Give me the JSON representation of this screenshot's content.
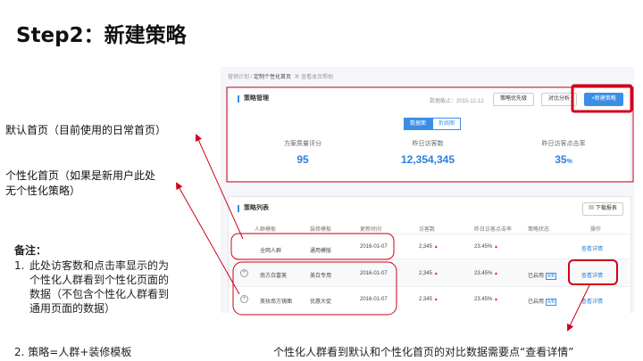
{
  "slide": {
    "title": "Step2：新建策略",
    "ann_default": "默认首页（目前使用的日常首页）",
    "ann_personal_1": "个性化首页（如果是新用户此处",
    "ann_personal_2": "无个性化策略）",
    "note_title": "备注：",
    "note1_num": "1.",
    "note1_text": "此处访客数和点击率显示的为个性化人群看到个性化页面的数据（不包含个性化人群看到通用页面的数据）",
    "note2": "2. 策略=人群+装修模板",
    "bottom_ann": "个性化人群看到默认和个性化首页的对比数据需要点“查看详情”"
  },
  "screenshot": {
    "breadcrumb": {
      "root": "营销计划",
      "sep": "/",
      "current": "定制个性化首页",
      "help": "查看本页帮助"
    },
    "strategy_mgmt": {
      "title": "策略管理",
      "deadline": "数据截止：2015-12-12",
      "priority_btn": "策略优先级",
      "compare_btn": "对比分析",
      "new_btn": "+新建策略",
      "tabs": [
        "数据面",
        "折线图"
      ],
      "metrics": [
        {
          "label": "方案质量评分",
          "value": "95",
          "unit": ""
        },
        {
          "label": "昨日访客数",
          "value": "12,354,345",
          "unit": ""
        },
        {
          "label": "昨日访客点击率",
          "value": "35",
          "unit": "%"
        }
      ]
    },
    "strategy_list": {
      "title": "策略列表",
      "download_btn": "下载报表",
      "columns": [
        "人群模板",
        "装修模板",
        "更新时间",
        "访客数",
        "昨日访客点击率",
        "策略状态",
        "操作"
      ],
      "rows": [
        {
          "crowd": "全网人群",
          "template": "通用模版",
          "date": "2016-01-07",
          "visitors": "2,345",
          "ctr": "23.45%",
          "status": "",
          "badge": "",
          "action": "查看详情",
          "expand": ""
        },
        {
          "crowd": "南方白富美",
          "template": "美白专用",
          "date": "2016-01-07",
          "visitors": "2,345",
          "ctr": "23.45%",
          "status": "已启用",
          "badge": "A/B",
          "action": "查看详情",
          "expand": "+"
        },
        {
          "crowd": "美妆南方镜面",
          "template": "优惠大促",
          "date": "2016-01-07",
          "visitors": "2,345",
          "ctr": "23.45%",
          "status": "已启用",
          "badge": "A/B",
          "action": "查看详情",
          "expand": "+"
        }
      ]
    }
  },
  "colors": {
    "accent": "#3a8ee6",
    "highlight": "#d0021b",
    "value_blue": "#2d7fd6"
  }
}
